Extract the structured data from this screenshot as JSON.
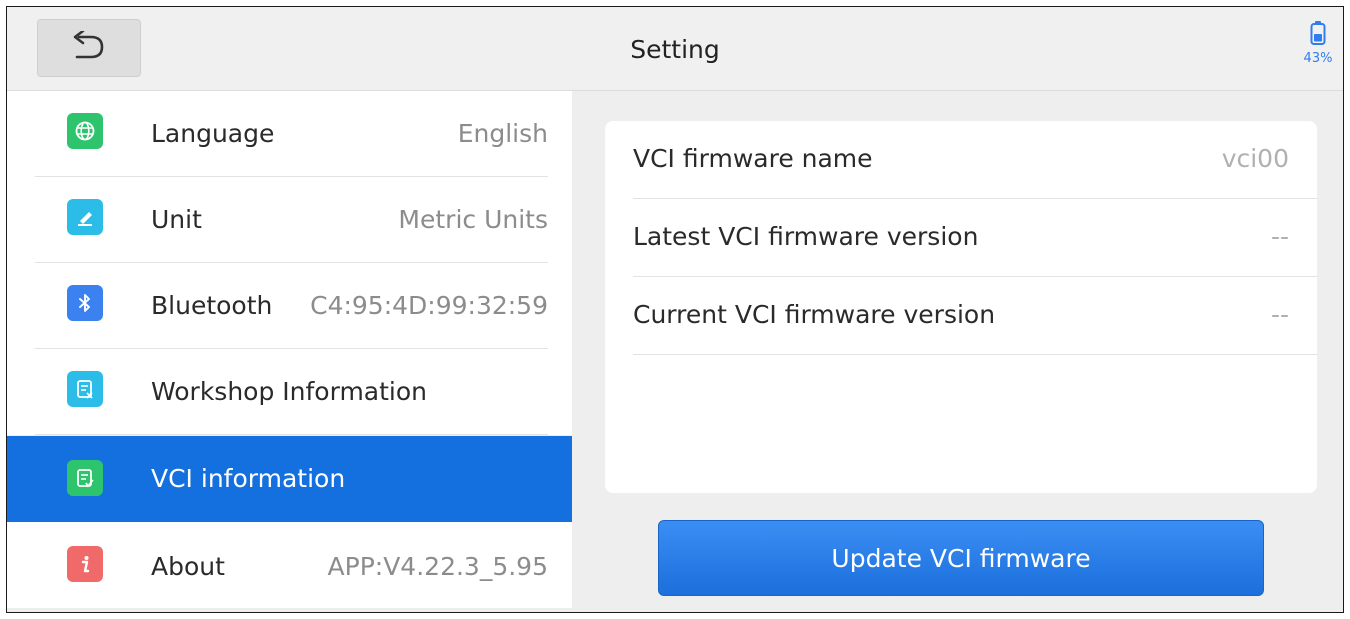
{
  "header": {
    "title": "Setting",
    "battery_percent": "43%",
    "back_icon": "back-arrow-icon"
  },
  "sidebar": {
    "items": [
      {
        "label": "Language",
        "value": "English",
        "icon": "globe-icon",
        "icon_color": "#2ec46e",
        "active": false
      },
      {
        "label": "Unit",
        "value": "Metric Units",
        "icon": "ruler-icon",
        "icon_color": "#2bbde8",
        "active": false
      },
      {
        "label": "Bluetooth",
        "value": "C4:95:4D:99:32:59",
        "icon": "bluetooth-icon",
        "icon_color": "#3b82f0",
        "active": false
      },
      {
        "label": "Workshop Information",
        "value": "",
        "icon": "workshop-doc-icon",
        "icon_color": "#2bbde8",
        "active": false
      },
      {
        "label": "VCI information",
        "value": "",
        "icon": "vci-doc-icon",
        "icon_color": "#2ec46e",
        "active": true
      },
      {
        "label": "About",
        "value": "APP:V4.22.3_5.95",
        "icon": "info-icon",
        "icon_color": "#f06a6a",
        "active": false
      }
    ]
  },
  "vci": {
    "rows": [
      {
        "label": "VCI firmware name",
        "value": "vci00"
      },
      {
        "label": "Latest VCI firmware version",
        "value": "--"
      },
      {
        "label": "Current VCI firmware version",
        "value": "--"
      }
    ],
    "update_button_label": "Update VCI firmware"
  },
  "colors": {
    "accent": "#1470df",
    "button": "#2a7fe8"
  }
}
